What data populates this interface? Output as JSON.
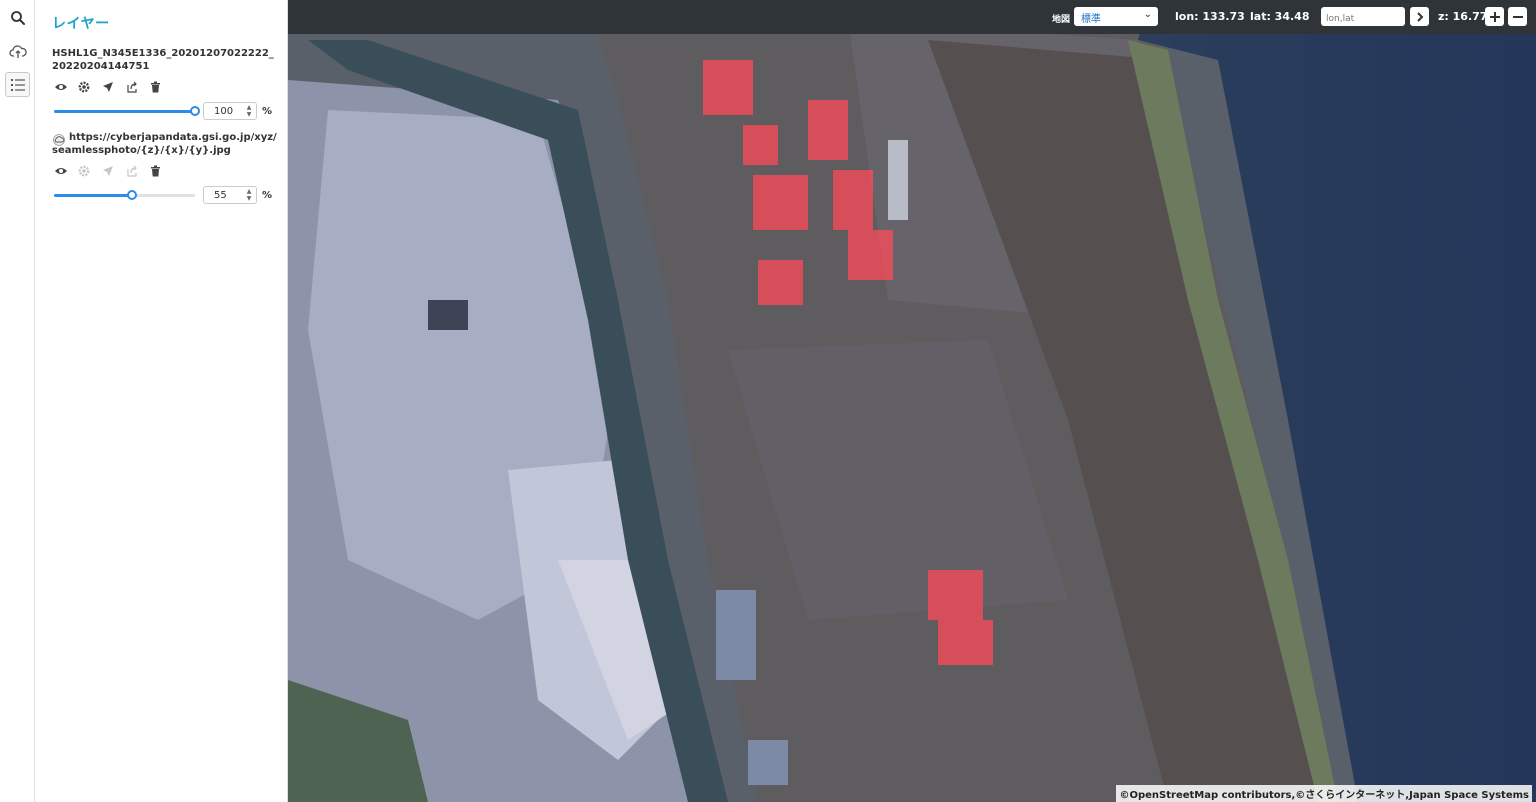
{
  "rail": {
    "items": [
      {
        "name": "search-icon"
      },
      {
        "name": "cloud-upload-icon"
      },
      {
        "name": "layer-list-icon"
      }
    ]
  },
  "panel": {
    "title": "レイヤー",
    "layers": [
      {
        "name": "HSHL1G_N345E1336_20201207022222_20220204144751",
        "opacity": 100,
        "opacity_unit": "%",
        "tools": [
          "eye-icon",
          "gear-icon",
          "locate-arrow-icon",
          "export-icon",
          "trash-icon"
        ]
      },
      {
        "name": "https://cyberjapandata.gsi.go.jp/xyz/seamlessphoto/{z}/{x}/{y}.jpg",
        "opacity": 55,
        "opacity_unit": "%",
        "tools": [
          "eye-icon",
          "gear-icon",
          "locate-arrow-icon",
          "export-icon",
          "trash-icon"
        ]
      }
    ]
  },
  "topbar": {
    "basemap_label": "地図",
    "basemap_value": "標準",
    "lon_text": "lon: 133.73",
    "lat_text": "lat: 34.48",
    "coord_placeholder": "lon,lat",
    "zoom_text": "z: 16.77"
  },
  "attribution": "©OpenStreetMap contributors,©さくらインターネット,Japan Space Systems",
  "colors": {
    "accent": "#1aa3c8",
    "slider": "#2b8de8",
    "topbar": "#2f3438",
    "heat": "#ff4a5a"
  }
}
